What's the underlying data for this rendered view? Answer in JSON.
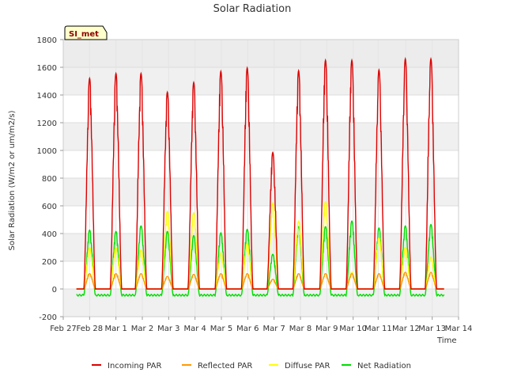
{
  "chart_data": {
    "type": "line",
    "title": "Solar Radiation",
    "xlabel": "Time",
    "ylabel": "Solar Radiation (W/m2 or um/m2/s)",
    "ylim": [
      -200,
      1800
    ],
    "yticks": [
      -200,
      0,
      200,
      400,
      600,
      800,
      1000,
      1200,
      1400,
      1600,
      1800
    ],
    "xlim": [
      0,
      15
    ],
    "xticks": [
      {
        "x": 0,
        "label": "Feb 27"
      },
      {
        "x": 1,
        "label": "Feb 28"
      },
      {
        "x": 2,
        "label": "Mar 1"
      },
      {
        "x": 3,
        "label": "Mar 2"
      },
      {
        "x": 4,
        "label": "Mar 3"
      },
      {
        "x": 5,
        "label": "Mar 4"
      },
      {
        "x": 6,
        "label": "Mar 5"
      },
      {
        "x": 7,
        "label": "Mar 6"
      },
      {
        "x": 8,
        "label": "Mar 7"
      },
      {
        "x": 9,
        "label": "Mar 8"
      },
      {
        "x": 10,
        "label": "Mar 9"
      },
      {
        "x": 11,
        "label": "Mar 10"
      },
      {
        "x": 11.95,
        "label": "Mar 11"
      },
      {
        "x": 13,
        "label": "Mar 12"
      },
      {
        "x": 14,
        "label": "Mar 13"
      },
      {
        "x": 15,
        "label": "Mar 14"
      }
    ],
    "grid": true,
    "legend": "bottom",
    "day_centers": [
      1.0,
      2.0,
      2.95,
      3.95,
      4.95,
      5.98,
      6.98,
      7.95,
      8.93,
      9.95,
      10.95,
      11.98,
      12.98,
      13.95
    ],
    "series": [
      {
        "name": "Incoming PAR",
        "color": "#dd0000",
        "values": [
          1520,
          1555,
          1555,
          1420,
          1490,
          1570,
          1595,
          985,
          1575,
          1650,
          1650,
          1580,
          1660,
          1660
        ]
      },
      {
        "name": "Reflected PAR",
        "color": "#ff9900",
        "values": [
          110,
          110,
          110,
          90,
          105,
          110,
          110,
          70,
          110,
          110,
          110,
          110,
          120,
          120
        ]
      },
      {
        "name": "Diffuse PAR",
        "color": "#ffff00",
        "values": [
          300,
          300,
          280,
          560,
          550,
          260,
          330,
          620,
          490,
          630,
          120,
          370,
          300,
          230
        ]
      },
      {
        "name": "Net Radiation",
        "color": "#00dd00",
        "values": [
          425,
          415,
          455,
          415,
          385,
          405,
          430,
          250,
          450,
          450,
          490,
          440,
          455,
          465
        ]
      }
    ],
    "night_values": {
      "Incoming PAR": 0,
      "Reflected PAR": 0,
      "Diffuse PAR": 0,
      "Net Radiation": -45
    }
  },
  "badge": "SI_met"
}
